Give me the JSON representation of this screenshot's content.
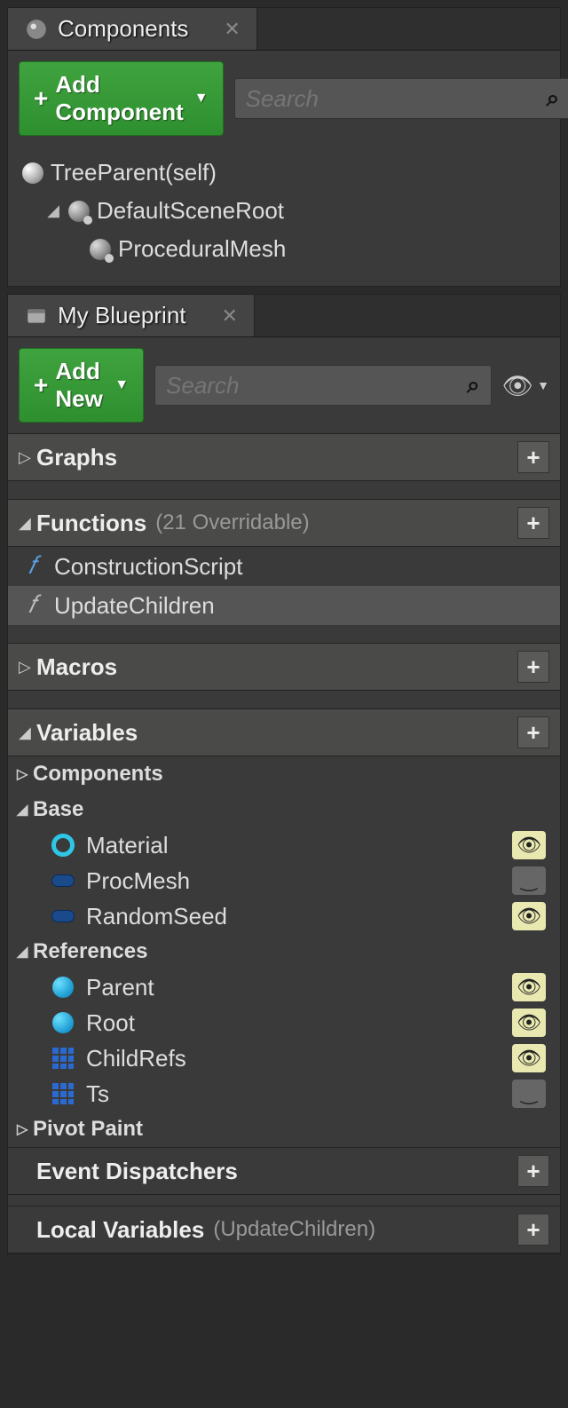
{
  "components": {
    "tabTitle": "Components",
    "addButton": "Add Component",
    "searchPlaceholder": "Search",
    "tree": {
      "root": "TreeParent(self)",
      "sceneRoot": "DefaultSceneRoot",
      "procMesh": "ProceduralMesh"
    }
  },
  "blueprint": {
    "tabTitle": "My Blueprint",
    "addButton": "Add New",
    "searchPlaceholder": "Search",
    "sections": {
      "graphs": {
        "title": "Graphs"
      },
      "functions": {
        "title": "Functions",
        "subtitle": "(21 Overridable)",
        "items": [
          "ConstructionScript",
          "UpdateChildren"
        ]
      },
      "macros": {
        "title": "Macros"
      },
      "variables": {
        "title": "Variables",
        "groups": {
          "components": "Components",
          "base": {
            "title": "Base",
            "vars": [
              "Material",
              "ProcMesh",
              "RandomSeed"
            ]
          },
          "references": {
            "title": "References",
            "vars": [
              "Parent",
              "Root",
              "ChildRefs",
              "Ts"
            ]
          },
          "pivotPaint": "Pivot Paint"
        }
      },
      "eventDispatchers": {
        "title": "Event Dispatchers"
      },
      "localVariables": {
        "title": "Local Variables",
        "subtitle": "(UpdateChildren)"
      }
    }
  }
}
